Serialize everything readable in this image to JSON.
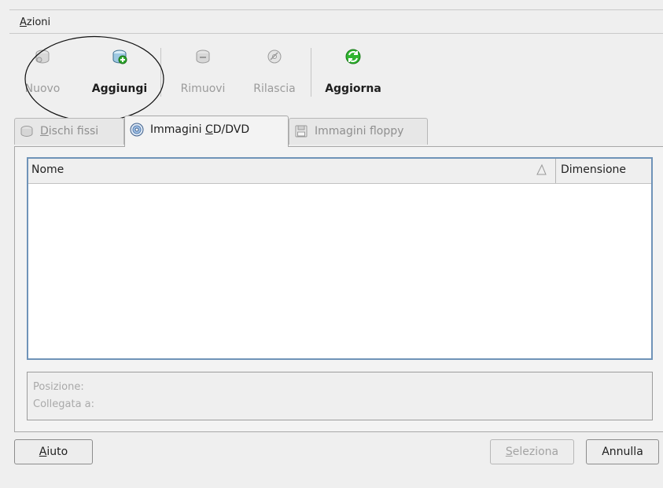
{
  "menu": {
    "actions_prefix": "A",
    "actions_rest": "zioni"
  },
  "toolbar": {
    "new_label": "Nuovo",
    "add_label": "Aggiungi",
    "remove_label": "Rimuovi",
    "release_label": "Rilascia",
    "refresh_label": "Aggiorna"
  },
  "tabs": [
    {
      "mnemonic": "D",
      "rest": "ischi fissi",
      "state": "inactive"
    },
    {
      "before": "Immagini ",
      "mnemonic": "C",
      "rest": "D/DVD",
      "state": "active"
    },
    {
      "label": "Immagini floppy",
      "state": "inactive"
    }
  ],
  "list": {
    "columns": [
      "Nome",
      "Dimensione"
    ],
    "sort_order": "ascending",
    "rows": []
  },
  "info": {
    "location_label": "Posizione:",
    "attached_label": "Collegata a:"
  },
  "buttons": {
    "help_mnemonic": "A",
    "help_rest": "iuto",
    "select_mnemonic": "S",
    "select_rest": "eleziona",
    "cancel_label": "Annulla"
  },
  "colors": {
    "list_focus_border": "#6f93b8",
    "refresh_icon": "#2fb52f",
    "add_icon_badge": "#2ea92e"
  },
  "icons": {
    "new": "disk-new-icon",
    "add": "disk-add-icon",
    "remove": "disk-remove-icon",
    "release": "disk-release-icon",
    "refresh": "refresh-icon",
    "tab_hard_disks": "hard-disk-icon",
    "tab_cd": "cd-dvd-icon",
    "tab_floppy": "floppy-icon"
  }
}
